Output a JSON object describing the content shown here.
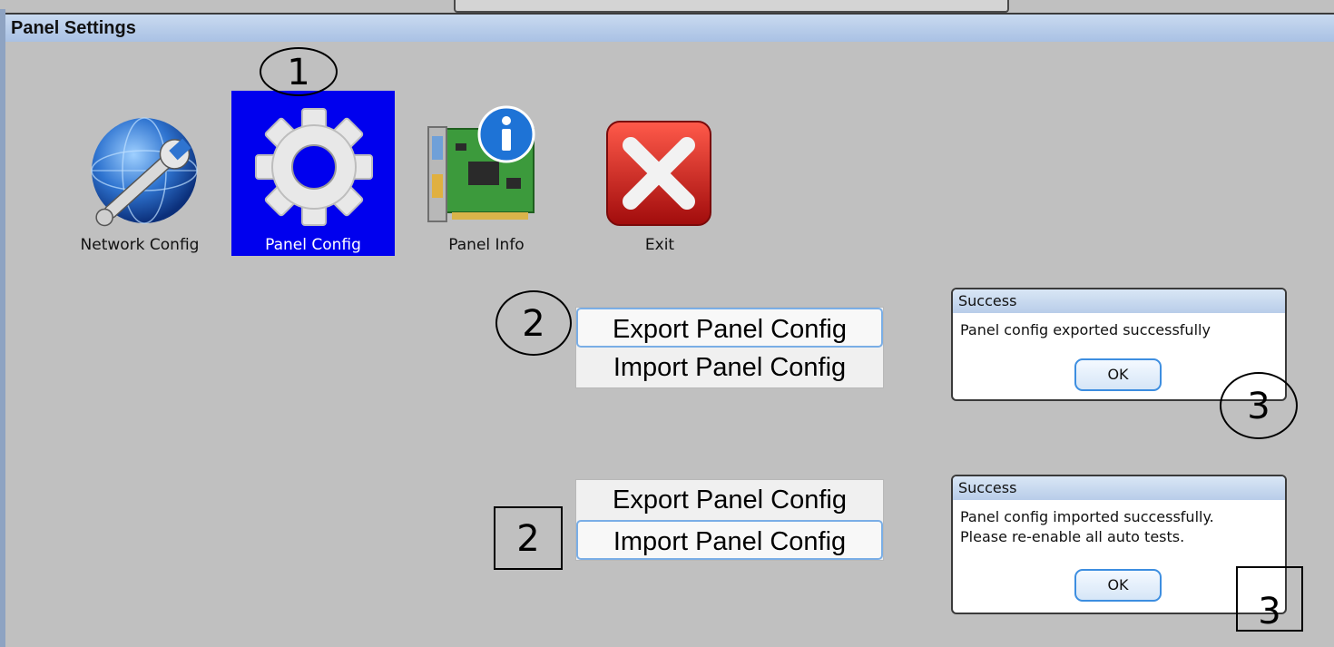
{
  "window": {
    "title": "Panel Settings"
  },
  "toolbar": {
    "items": [
      {
        "label": "Network Config",
        "icon": "network-config-icon"
      },
      {
        "label": "Panel Config",
        "icon": "gear-icon",
        "selected": true
      },
      {
        "label": "Panel Info",
        "icon": "panel-info-icon"
      },
      {
        "label": "Exit",
        "icon": "exit-icon"
      }
    ]
  },
  "menus": [
    {
      "items": [
        "Export Panel Config",
        "Import Panel Config"
      ],
      "highlighted": 0
    },
    {
      "items": [
        "Export Panel Config",
        "Import Panel Config"
      ],
      "highlighted": 1
    }
  ],
  "dialogs": [
    {
      "title": "Success",
      "message_lines": [
        "Panel config exported successfully"
      ],
      "ok_label": "OK"
    },
    {
      "title": "Success",
      "message_lines": [
        "Panel config imported successfully.",
        "Please re-enable all auto tests."
      ],
      "ok_label": "OK"
    }
  ],
  "annotations": {
    "step1": "1",
    "step2a": "2",
    "step2b": "2",
    "step3a": "3",
    "step3b": "3"
  },
  "colors": {
    "selection": "#0000ee",
    "focus_border": "#7aaee6",
    "titlebar": "#b8cde9"
  }
}
